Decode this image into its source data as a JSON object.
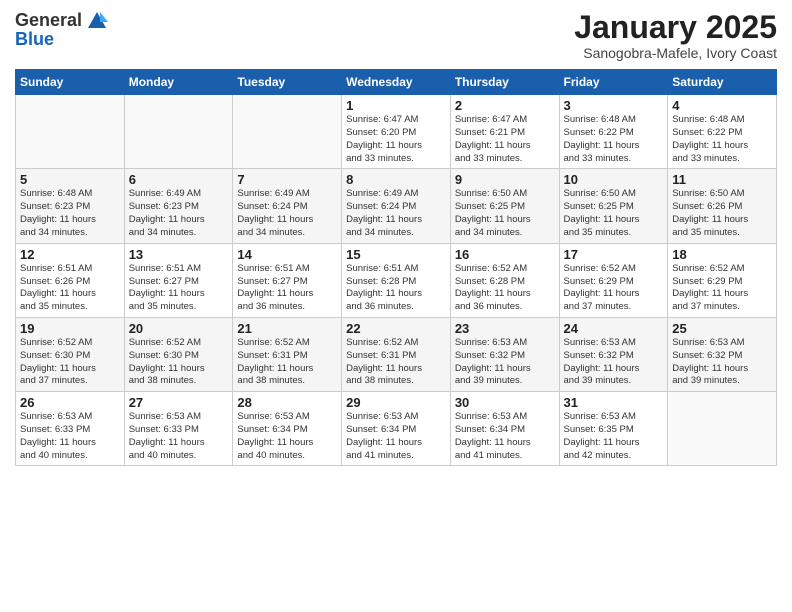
{
  "header": {
    "logo_general": "General",
    "logo_blue": "Blue",
    "month_title": "January 2025",
    "subtitle": "Sanogobra-Mafele, Ivory Coast"
  },
  "weekdays": [
    "Sunday",
    "Monday",
    "Tuesday",
    "Wednesday",
    "Thursday",
    "Friday",
    "Saturday"
  ],
  "weeks": [
    [
      {
        "day": "",
        "info": ""
      },
      {
        "day": "",
        "info": ""
      },
      {
        "day": "",
        "info": ""
      },
      {
        "day": "1",
        "info": "Sunrise: 6:47 AM\nSunset: 6:20 PM\nDaylight: 11 hours\nand 33 minutes."
      },
      {
        "day": "2",
        "info": "Sunrise: 6:47 AM\nSunset: 6:21 PM\nDaylight: 11 hours\nand 33 minutes."
      },
      {
        "day": "3",
        "info": "Sunrise: 6:48 AM\nSunset: 6:22 PM\nDaylight: 11 hours\nand 33 minutes."
      },
      {
        "day": "4",
        "info": "Sunrise: 6:48 AM\nSunset: 6:22 PM\nDaylight: 11 hours\nand 33 minutes."
      }
    ],
    [
      {
        "day": "5",
        "info": "Sunrise: 6:48 AM\nSunset: 6:23 PM\nDaylight: 11 hours\nand 34 minutes."
      },
      {
        "day": "6",
        "info": "Sunrise: 6:49 AM\nSunset: 6:23 PM\nDaylight: 11 hours\nand 34 minutes."
      },
      {
        "day": "7",
        "info": "Sunrise: 6:49 AM\nSunset: 6:24 PM\nDaylight: 11 hours\nand 34 minutes."
      },
      {
        "day": "8",
        "info": "Sunrise: 6:49 AM\nSunset: 6:24 PM\nDaylight: 11 hours\nand 34 minutes."
      },
      {
        "day": "9",
        "info": "Sunrise: 6:50 AM\nSunset: 6:25 PM\nDaylight: 11 hours\nand 34 minutes."
      },
      {
        "day": "10",
        "info": "Sunrise: 6:50 AM\nSunset: 6:25 PM\nDaylight: 11 hours\nand 35 minutes."
      },
      {
        "day": "11",
        "info": "Sunrise: 6:50 AM\nSunset: 6:26 PM\nDaylight: 11 hours\nand 35 minutes."
      }
    ],
    [
      {
        "day": "12",
        "info": "Sunrise: 6:51 AM\nSunset: 6:26 PM\nDaylight: 11 hours\nand 35 minutes."
      },
      {
        "day": "13",
        "info": "Sunrise: 6:51 AM\nSunset: 6:27 PM\nDaylight: 11 hours\nand 35 minutes."
      },
      {
        "day": "14",
        "info": "Sunrise: 6:51 AM\nSunset: 6:27 PM\nDaylight: 11 hours\nand 36 minutes."
      },
      {
        "day": "15",
        "info": "Sunrise: 6:51 AM\nSunset: 6:28 PM\nDaylight: 11 hours\nand 36 minutes."
      },
      {
        "day": "16",
        "info": "Sunrise: 6:52 AM\nSunset: 6:28 PM\nDaylight: 11 hours\nand 36 minutes."
      },
      {
        "day": "17",
        "info": "Sunrise: 6:52 AM\nSunset: 6:29 PM\nDaylight: 11 hours\nand 37 minutes."
      },
      {
        "day": "18",
        "info": "Sunrise: 6:52 AM\nSunset: 6:29 PM\nDaylight: 11 hours\nand 37 minutes."
      }
    ],
    [
      {
        "day": "19",
        "info": "Sunrise: 6:52 AM\nSunset: 6:30 PM\nDaylight: 11 hours\nand 37 minutes."
      },
      {
        "day": "20",
        "info": "Sunrise: 6:52 AM\nSunset: 6:30 PM\nDaylight: 11 hours\nand 38 minutes."
      },
      {
        "day": "21",
        "info": "Sunrise: 6:52 AM\nSunset: 6:31 PM\nDaylight: 11 hours\nand 38 minutes."
      },
      {
        "day": "22",
        "info": "Sunrise: 6:52 AM\nSunset: 6:31 PM\nDaylight: 11 hours\nand 38 minutes."
      },
      {
        "day": "23",
        "info": "Sunrise: 6:53 AM\nSunset: 6:32 PM\nDaylight: 11 hours\nand 39 minutes."
      },
      {
        "day": "24",
        "info": "Sunrise: 6:53 AM\nSunset: 6:32 PM\nDaylight: 11 hours\nand 39 minutes."
      },
      {
        "day": "25",
        "info": "Sunrise: 6:53 AM\nSunset: 6:32 PM\nDaylight: 11 hours\nand 39 minutes."
      }
    ],
    [
      {
        "day": "26",
        "info": "Sunrise: 6:53 AM\nSunset: 6:33 PM\nDaylight: 11 hours\nand 40 minutes."
      },
      {
        "day": "27",
        "info": "Sunrise: 6:53 AM\nSunset: 6:33 PM\nDaylight: 11 hours\nand 40 minutes."
      },
      {
        "day": "28",
        "info": "Sunrise: 6:53 AM\nSunset: 6:34 PM\nDaylight: 11 hours\nand 40 minutes."
      },
      {
        "day": "29",
        "info": "Sunrise: 6:53 AM\nSunset: 6:34 PM\nDaylight: 11 hours\nand 41 minutes."
      },
      {
        "day": "30",
        "info": "Sunrise: 6:53 AM\nSunset: 6:34 PM\nDaylight: 11 hours\nand 41 minutes."
      },
      {
        "day": "31",
        "info": "Sunrise: 6:53 AM\nSunset: 6:35 PM\nDaylight: 11 hours\nand 42 minutes."
      },
      {
        "day": "",
        "info": ""
      }
    ]
  ]
}
